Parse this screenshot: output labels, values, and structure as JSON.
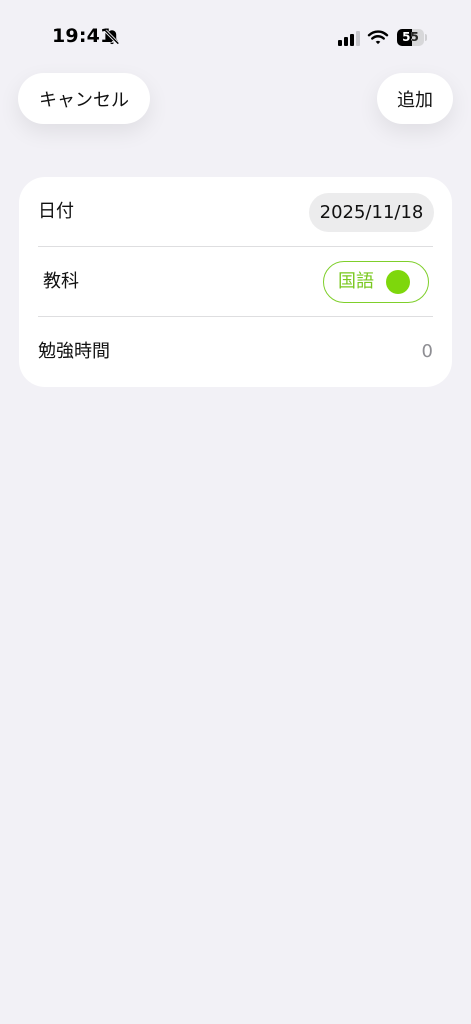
{
  "status_bar": {
    "time": "19:41",
    "battery_label": "55",
    "battery_level": 0.55
  },
  "navigation": {
    "cancel_label": "キャンセル",
    "add_label": "追加"
  },
  "form": {
    "date_label": "日付",
    "date_value": "2025/11/18",
    "subject_label": "教科",
    "subject_value": "国語",
    "study_time_label": "勉強時間",
    "study_time_value": "0"
  },
  "colors": {
    "accent_green": "#7ed70c",
    "background": "#f2f1f6"
  },
  "icons": {
    "status_bell": "bell-slash-icon",
    "status_signal": "cellular-signal-icon",
    "status_wifi": "wifi-icon"
  }
}
